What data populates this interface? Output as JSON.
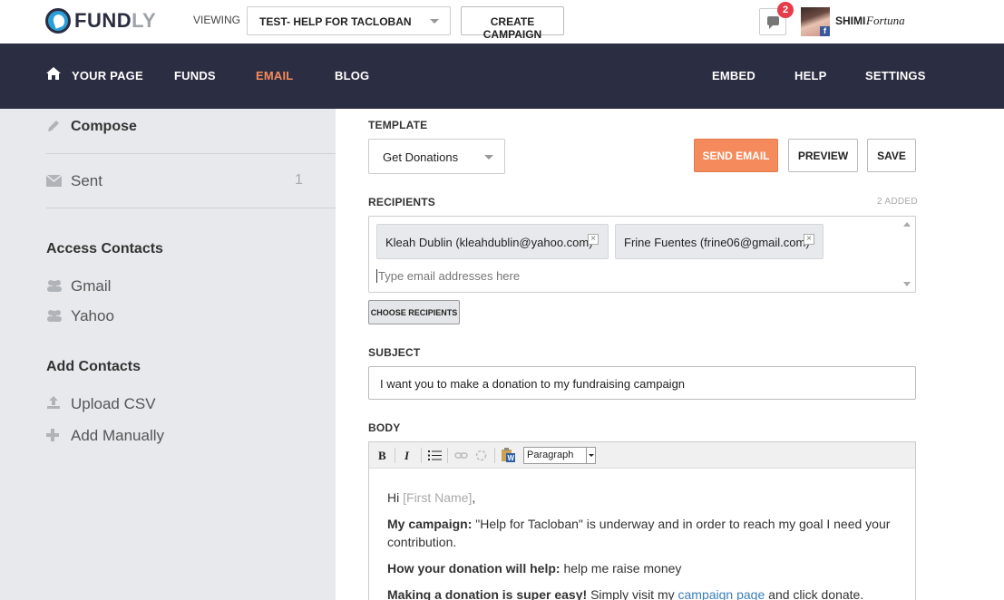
{
  "brand": {
    "logo_dark": "FUND",
    "logo_light": "LY"
  },
  "topbar": {
    "viewing_label": "VIEWING",
    "campaign_selected": "TEST- HELP FOR TACLOBAN",
    "create_campaign": "CREATE CAMPAIGN",
    "notification_count": "2",
    "user_first": "SHIMI",
    "user_last": "Fortuna"
  },
  "nav": {
    "your_page": "YOUR PAGE",
    "funds": "FUNDS",
    "email": "EMAIL",
    "blog": "BLOG",
    "embed": "EMBED",
    "help": "HELP",
    "settings": "SETTINGS"
  },
  "sidebar": {
    "compose": "Compose",
    "sent": "Sent",
    "sent_count": "1",
    "access_heading": "Access Contacts",
    "gmail": "Gmail",
    "yahoo": "Yahoo",
    "add_heading": "Add Contacts",
    "upload_csv": "Upload CSV",
    "add_manually": "Add Manually"
  },
  "form": {
    "template_label": "TEMPLATE",
    "template_value": "Get Donations",
    "send_email": "SEND EMAIL",
    "preview": "PREVIEW",
    "save": "SAVE",
    "recipients_label": "RECIPIENTS",
    "recipients_added": "2 ADDED",
    "recipients": [
      "Kleah Dublin (kleahdublin@yahoo.com)",
      "Frine Fuentes (frine06@gmail.com)"
    ],
    "email_placeholder": "Type email addresses here",
    "choose_recipients": "CHOOSE RECIPIENTS",
    "subject_label": "SUBJECT",
    "subject_value": "I want you to make a donation to my fundraising campaign",
    "body_label": "BODY"
  },
  "editor": {
    "bold": "B",
    "italic": "I",
    "format": "Paragraph",
    "greeting": "Hi",
    "first_name_tag": "[First Name]",
    "greeting_end": ",",
    "campaign_label": "My campaign:",
    "campaign_text": "\"Help for Tacloban\" is underway and in order to reach my goal I need your contribution.",
    "help_label": "How your donation will help:",
    "help_text": "help me raise money",
    "easy_label": "Making a donation is super easy!",
    "easy_text_1": "Simply visit my",
    "easy_link": "campaign page",
    "easy_text_2": "and click donate."
  },
  "colors": {
    "nav_bg": "#2b2d42",
    "accent": "#f58b5c",
    "sidebar_bg": "#e7e9ec",
    "link": "#3b7fb8",
    "badge": "#e53b4a"
  },
  "icons": [
    "home-icon",
    "pencil-icon",
    "envelope-icon",
    "users-icon",
    "upload-icon",
    "plus-icon",
    "message-icon",
    "bold-icon",
    "italic-icon",
    "list-icon",
    "link-icon",
    "unlink-icon",
    "paste-word-icon"
  ]
}
